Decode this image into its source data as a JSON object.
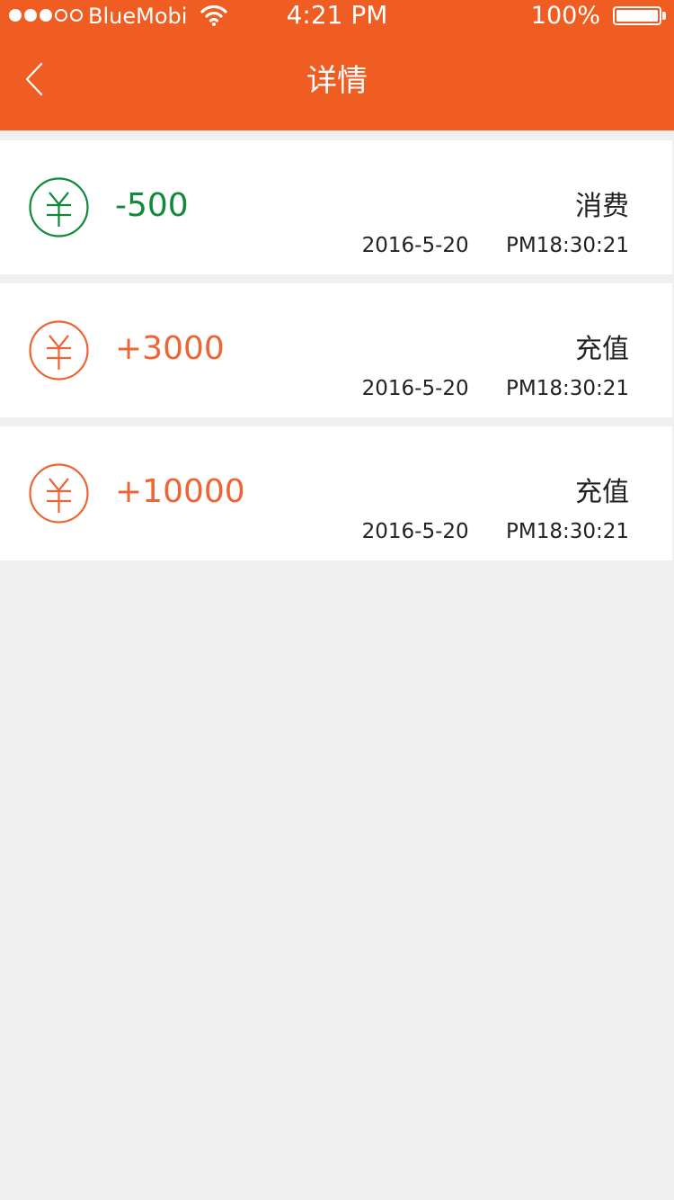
{
  "colors": {
    "brand": "#f05d22",
    "expense": "#108a3a",
    "income": "#ee6534",
    "background": "#f0f0f0"
  },
  "status_bar": {
    "carrier": "BlueMobi",
    "time": "4:21 PM",
    "battery_percent": "100%",
    "battery_level": 1.0,
    "signal_filled": 3,
    "signal_total": 5
  },
  "nav": {
    "title": "详情",
    "back_icon": "chevron-left-icon"
  },
  "records": [
    {
      "amount": "-500",
      "type": "消费",
      "date": "2016-5-20",
      "time": "PM18:30:21",
      "kind": "expense",
      "icon": "yen-icon"
    },
    {
      "amount": "+3000",
      "type": "充值",
      "date": "2016-5-20",
      "time": "PM18:30:21",
      "kind": "income",
      "icon": "yen-icon"
    },
    {
      "amount": "+10000",
      "type": "充值",
      "date": "2016-5-20",
      "time": "PM18:30:21",
      "kind": "income",
      "icon": "yen-icon"
    }
  ]
}
